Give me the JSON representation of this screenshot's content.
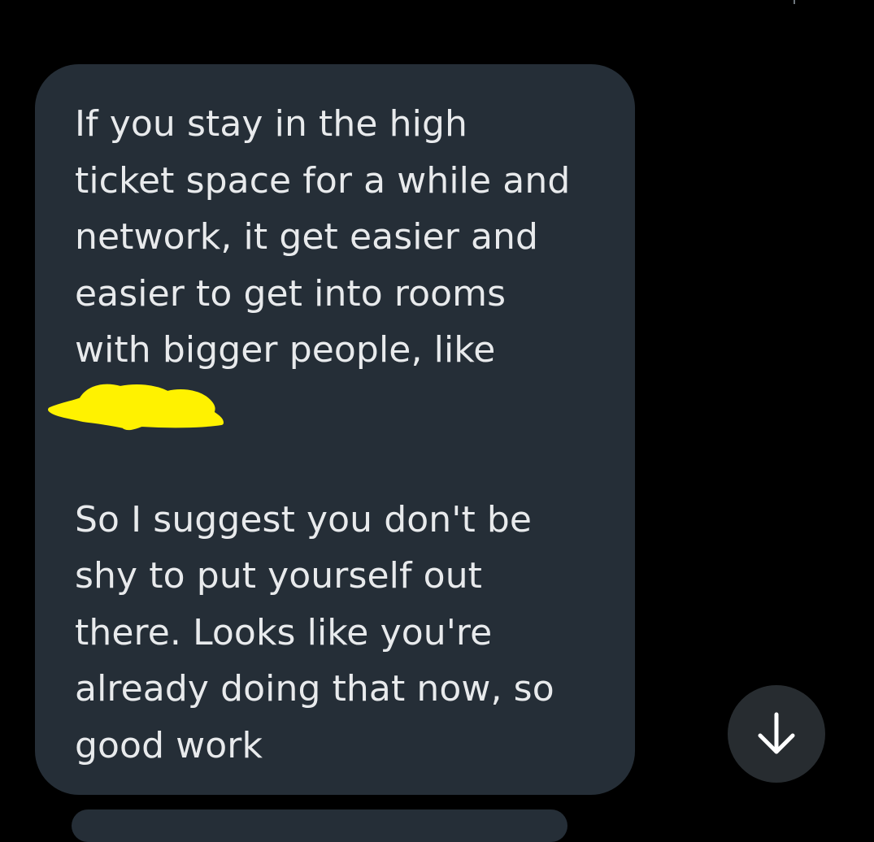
{
  "conversation": {
    "received_message": {
      "text": "If you stay in the high\nticket space for a while and\nnetwork, it get easier and\neasier to get into rooms\nwith bigger people, like\n \n \nSo I suggest you don't be\nshy to put yourself out\nthere. Looks like you're\nalready doing that now, so\ngood work",
      "redaction_color": "#fff200"
    },
    "bubble_color": "#252e37"
  },
  "scroll_down_button": {
    "icon": "arrow-down-icon"
  }
}
